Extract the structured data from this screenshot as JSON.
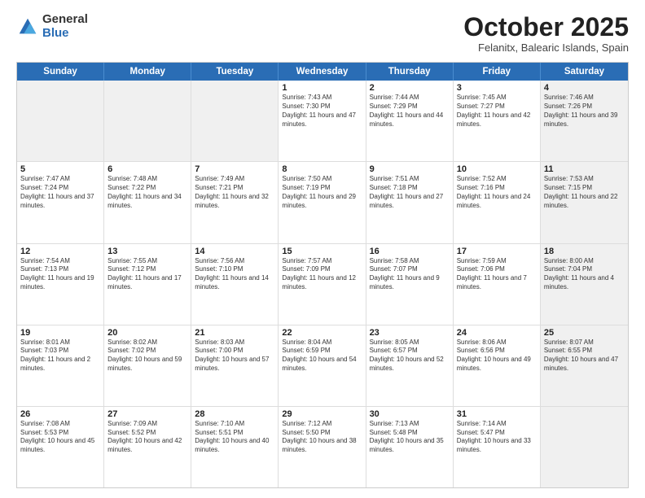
{
  "logo": {
    "general": "General",
    "blue": "Blue"
  },
  "header": {
    "month": "October 2025",
    "location": "Felanitx, Balearic Islands, Spain"
  },
  "days_of_week": [
    "Sunday",
    "Monday",
    "Tuesday",
    "Wednesday",
    "Thursday",
    "Friday",
    "Saturday"
  ],
  "rows": [
    [
      {
        "day": "",
        "info": "",
        "shaded": true
      },
      {
        "day": "",
        "info": "",
        "shaded": true
      },
      {
        "day": "",
        "info": "",
        "shaded": true
      },
      {
        "day": "1",
        "info": "Sunrise: 7:43 AM\nSunset: 7:30 PM\nDaylight: 11 hours and 47 minutes."
      },
      {
        "day": "2",
        "info": "Sunrise: 7:44 AM\nSunset: 7:29 PM\nDaylight: 11 hours and 44 minutes."
      },
      {
        "day": "3",
        "info": "Sunrise: 7:45 AM\nSunset: 7:27 PM\nDaylight: 11 hours and 42 minutes."
      },
      {
        "day": "4",
        "info": "Sunrise: 7:46 AM\nSunset: 7:26 PM\nDaylight: 11 hours and 39 minutes.",
        "shaded": true
      }
    ],
    [
      {
        "day": "5",
        "info": "Sunrise: 7:47 AM\nSunset: 7:24 PM\nDaylight: 11 hours and 37 minutes."
      },
      {
        "day": "6",
        "info": "Sunrise: 7:48 AM\nSunset: 7:22 PM\nDaylight: 11 hours and 34 minutes."
      },
      {
        "day": "7",
        "info": "Sunrise: 7:49 AM\nSunset: 7:21 PM\nDaylight: 11 hours and 32 minutes."
      },
      {
        "day": "8",
        "info": "Sunrise: 7:50 AM\nSunset: 7:19 PM\nDaylight: 11 hours and 29 minutes."
      },
      {
        "day": "9",
        "info": "Sunrise: 7:51 AM\nSunset: 7:18 PM\nDaylight: 11 hours and 27 minutes."
      },
      {
        "day": "10",
        "info": "Sunrise: 7:52 AM\nSunset: 7:16 PM\nDaylight: 11 hours and 24 minutes."
      },
      {
        "day": "11",
        "info": "Sunrise: 7:53 AM\nSunset: 7:15 PM\nDaylight: 11 hours and 22 minutes.",
        "shaded": true
      }
    ],
    [
      {
        "day": "12",
        "info": "Sunrise: 7:54 AM\nSunset: 7:13 PM\nDaylight: 11 hours and 19 minutes."
      },
      {
        "day": "13",
        "info": "Sunrise: 7:55 AM\nSunset: 7:12 PM\nDaylight: 11 hours and 17 minutes."
      },
      {
        "day": "14",
        "info": "Sunrise: 7:56 AM\nSunset: 7:10 PM\nDaylight: 11 hours and 14 minutes."
      },
      {
        "day": "15",
        "info": "Sunrise: 7:57 AM\nSunset: 7:09 PM\nDaylight: 11 hours and 12 minutes."
      },
      {
        "day": "16",
        "info": "Sunrise: 7:58 AM\nSunset: 7:07 PM\nDaylight: 11 hours and 9 minutes."
      },
      {
        "day": "17",
        "info": "Sunrise: 7:59 AM\nSunset: 7:06 PM\nDaylight: 11 hours and 7 minutes."
      },
      {
        "day": "18",
        "info": "Sunrise: 8:00 AM\nSunset: 7:04 PM\nDaylight: 11 hours and 4 minutes.",
        "shaded": true
      }
    ],
    [
      {
        "day": "19",
        "info": "Sunrise: 8:01 AM\nSunset: 7:03 PM\nDaylight: 11 hours and 2 minutes."
      },
      {
        "day": "20",
        "info": "Sunrise: 8:02 AM\nSunset: 7:02 PM\nDaylight: 10 hours and 59 minutes."
      },
      {
        "day": "21",
        "info": "Sunrise: 8:03 AM\nSunset: 7:00 PM\nDaylight: 10 hours and 57 minutes."
      },
      {
        "day": "22",
        "info": "Sunrise: 8:04 AM\nSunset: 6:59 PM\nDaylight: 10 hours and 54 minutes."
      },
      {
        "day": "23",
        "info": "Sunrise: 8:05 AM\nSunset: 6:57 PM\nDaylight: 10 hours and 52 minutes."
      },
      {
        "day": "24",
        "info": "Sunrise: 8:06 AM\nSunset: 6:56 PM\nDaylight: 10 hours and 49 minutes."
      },
      {
        "day": "25",
        "info": "Sunrise: 8:07 AM\nSunset: 6:55 PM\nDaylight: 10 hours and 47 minutes.",
        "shaded": true
      }
    ],
    [
      {
        "day": "26",
        "info": "Sunrise: 7:08 AM\nSunset: 5:53 PM\nDaylight: 10 hours and 45 minutes."
      },
      {
        "day": "27",
        "info": "Sunrise: 7:09 AM\nSunset: 5:52 PM\nDaylight: 10 hours and 42 minutes."
      },
      {
        "day": "28",
        "info": "Sunrise: 7:10 AM\nSunset: 5:51 PM\nDaylight: 10 hours and 40 minutes."
      },
      {
        "day": "29",
        "info": "Sunrise: 7:12 AM\nSunset: 5:50 PM\nDaylight: 10 hours and 38 minutes."
      },
      {
        "day": "30",
        "info": "Sunrise: 7:13 AM\nSunset: 5:48 PM\nDaylight: 10 hours and 35 minutes."
      },
      {
        "day": "31",
        "info": "Sunrise: 7:14 AM\nSunset: 5:47 PM\nDaylight: 10 hours and 33 minutes."
      },
      {
        "day": "",
        "info": "",
        "shaded": true
      }
    ]
  ]
}
